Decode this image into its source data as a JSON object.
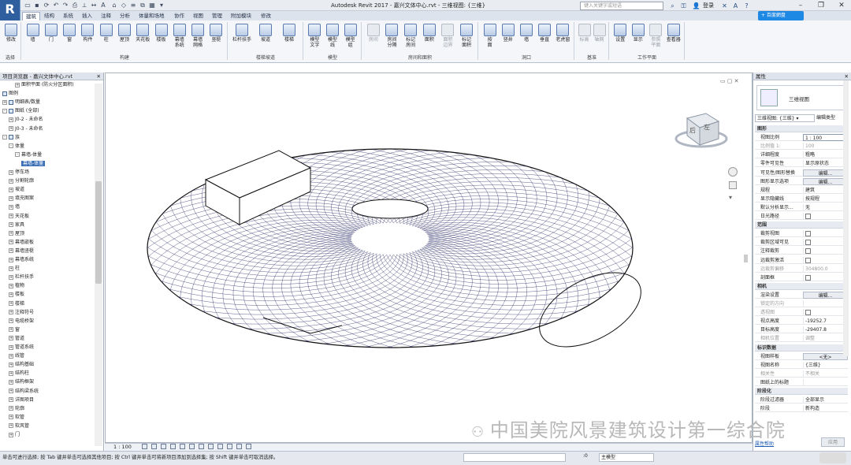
{
  "app": {
    "logo": "R",
    "window_title": "Autodesk Revit 2017 -    嘉兴文体中心.rvt - 三维视图: {三维}",
    "search_placeholder": "键入关键字或短语",
    "login": "登录",
    "cloud_button": "+ 百度網盘"
  },
  "tabs": [
    "建筑",
    "结构",
    "系统",
    "插入",
    "注释",
    "分析",
    "体量和场地",
    "协作",
    "视图",
    "管理",
    "附加模块",
    "修改"
  ],
  "active_tab": "建筑",
  "ribbon": {
    "modify": "修改",
    "select_label": "选择",
    "build": {
      "label": "构建",
      "items": [
        "墙",
        "门",
        "窗",
        "构件",
        "柱",
        "屋顶",
        "天花板",
        "楼板",
        "幕墙\n系统",
        "幕墙\n网格",
        "竖梃"
      ]
    },
    "circulation": {
      "label": "楼梯坡道",
      "items": [
        "栏杆扶手",
        "坡道",
        "楼梯"
      ]
    },
    "model": {
      "label": "模型",
      "items": [
        "模型\n文字",
        "模型\n线",
        "模型\n组"
      ]
    },
    "room": {
      "label": "房间和面积",
      "items": [
        "房间",
        "房间\n分隔",
        "标记\n房间",
        "面积",
        "面积\n边界",
        "标记\n面积"
      ]
    },
    "opening": {
      "label": "洞口",
      "items": [
        "按\n面",
        "竖井",
        "墙",
        "垂直",
        "老虎窗"
      ]
    },
    "datum": {
      "label": "基准",
      "items": [
        "标高",
        "轴网"
      ]
    },
    "workplane": {
      "label": "工作平面",
      "items": [
        "设置",
        "显示",
        "参照\n平面",
        "查看器"
      ]
    }
  },
  "browser": {
    "title": "项目浏览器 - 嘉兴文体中心.rvt",
    "items": [
      {
        "label": "面积平面 (防火分区面积)",
        "indent": 2,
        "toggle": "+",
        "icon": false
      },
      {
        "label": "图例",
        "indent": 0,
        "toggle": "",
        "icon": true
      },
      {
        "label": "明细表/数量",
        "indent": 0,
        "toggle": "+",
        "icon": true
      },
      {
        "label": "图纸 (全部)",
        "indent": 0,
        "toggle": "-",
        "icon": true
      },
      {
        "label": "J0-2 - 未命名",
        "indent": 1,
        "toggle": "+",
        "icon": false
      },
      {
        "label": "J0-3 - 未命名",
        "indent": 1,
        "toggle": "+",
        "icon": false
      },
      {
        "label": "族",
        "indent": 0,
        "toggle": "-",
        "icon": true
      },
      {
        "label": "体量",
        "indent": 1,
        "toggle": "-",
        "icon": false
      },
      {
        "label": "幕墙-体量",
        "indent": 2,
        "toggle": "-",
        "icon": false
      },
      {
        "label": "幕墙-体量",
        "indent": 3,
        "toggle": "",
        "icon": false,
        "selected": true
      },
      {
        "label": "停车场",
        "indent": 1,
        "toggle": "+",
        "icon": false
      },
      {
        "label": "分割轮廓",
        "indent": 1,
        "toggle": "+",
        "icon": false
      },
      {
        "label": "坡道",
        "indent": 1,
        "toggle": "+",
        "icon": false
      },
      {
        "label": "填充图案",
        "indent": 1,
        "toggle": "+",
        "icon": false
      },
      {
        "label": "墙",
        "indent": 1,
        "toggle": "+",
        "icon": false
      },
      {
        "label": "天花板",
        "indent": 1,
        "toggle": "+",
        "icon": false
      },
      {
        "label": "家具",
        "indent": 1,
        "toggle": "+",
        "icon": false
      },
      {
        "label": "屋顶",
        "indent": 1,
        "toggle": "+",
        "icon": false
      },
      {
        "label": "幕墙嵌板",
        "indent": 1,
        "toggle": "+",
        "icon": false
      },
      {
        "label": "幕墙竖梃",
        "indent": 1,
        "toggle": "+",
        "icon": false
      },
      {
        "label": "幕墙系统",
        "indent": 1,
        "toggle": "+",
        "icon": false
      },
      {
        "label": "柱",
        "indent": 1,
        "toggle": "+",
        "icon": false
      },
      {
        "label": "栏杆扶手",
        "indent": 1,
        "toggle": "+",
        "icon": false
      },
      {
        "label": "植物",
        "indent": 1,
        "toggle": "+",
        "icon": false
      },
      {
        "label": "楼板",
        "indent": 1,
        "toggle": "+",
        "icon": false
      },
      {
        "label": "楼梯",
        "indent": 1,
        "toggle": "+",
        "icon": false
      },
      {
        "label": "注释符号",
        "indent": 1,
        "toggle": "+",
        "icon": false
      },
      {
        "label": "电缆桥架",
        "indent": 1,
        "toggle": "+",
        "icon": false
      },
      {
        "label": "窗",
        "indent": 1,
        "toggle": "+",
        "icon": false
      },
      {
        "label": "管道",
        "indent": 1,
        "toggle": "+",
        "icon": false
      },
      {
        "label": "管道系统",
        "indent": 1,
        "toggle": "+",
        "icon": false
      },
      {
        "label": "线管",
        "indent": 1,
        "toggle": "+",
        "icon": false
      },
      {
        "label": "结构基础",
        "indent": 1,
        "toggle": "+",
        "icon": false
      },
      {
        "label": "结构柱",
        "indent": 1,
        "toggle": "+",
        "icon": false
      },
      {
        "label": "结构框架",
        "indent": 1,
        "toggle": "+",
        "icon": false
      },
      {
        "label": "结构梁系统",
        "indent": 1,
        "toggle": "+",
        "icon": false
      },
      {
        "label": "详图项目",
        "indent": 1,
        "toggle": "+",
        "icon": false
      },
      {
        "label": "轮廓",
        "indent": 1,
        "toggle": "+",
        "icon": false
      },
      {
        "label": "软管",
        "indent": 1,
        "toggle": "+",
        "icon": false
      },
      {
        "label": "软风管",
        "indent": 1,
        "toggle": "+",
        "icon": false
      },
      {
        "label": "门",
        "indent": 1,
        "toggle": "+",
        "icon": false
      }
    ]
  },
  "properties": {
    "title": "属性",
    "type_name": "三维视图",
    "selector": "三维视图: {三维}",
    "edit_type": "编辑类型",
    "rows": [
      {
        "group": "图形"
      },
      {
        "k": "视图比例",
        "v": "1 : 100",
        "input": true
      },
      {
        "k": "比例值 1:",
        "v": "100",
        "dis": true
      },
      {
        "k": "详细程度",
        "v": "粗略"
      },
      {
        "k": "零件可见性",
        "v": "显示原状态"
      },
      {
        "k": "可见性/图形替换",
        "v": "编辑...",
        "btn": true
      },
      {
        "k": "图形显示选项",
        "v": "编辑...",
        "btn": true
      },
      {
        "k": "规程",
        "v": "建筑"
      },
      {
        "k": "显示隐藏线",
        "v": "按规程"
      },
      {
        "k": "默认分析显示...",
        "v": "无"
      },
      {
        "k": "日光路径",
        "v": "",
        "cb": true
      },
      {
        "group": "范围"
      },
      {
        "k": "裁剪视图",
        "v": "",
        "cb": true
      },
      {
        "k": "裁剪区域可见",
        "v": "",
        "cb": true
      },
      {
        "k": "注释裁剪",
        "v": "",
        "cb": true
      },
      {
        "k": "远裁剪激活",
        "v": "",
        "cb": true
      },
      {
        "k": "远裁剪偏移",
        "v": "304800.0",
        "dis": true
      },
      {
        "k": "剖面框",
        "v": "",
        "cb": true
      },
      {
        "group": "相机"
      },
      {
        "k": "渲染设置",
        "v": "编辑...",
        "btn": true
      },
      {
        "k": "锁定的方向",
        "v": "",
        "dis": true
      },
      {
        "k": "透视图",
        "v": "",
        "dis": true,
        "cb": true
      },
      {
        "k": "视点高度",
        "v": "-19252.7"
      },
      {
        "k": "目标高度",
        "v": "-29407.8"
      },
      {
        "k": "相机位置",
        "v": "调整",
        "dis": true
      },
      {
        "group": "标识数据"
      },
      {
        "k": "视图样板",
        "v": "<无>",
        "btn": true
      },
      {
        "k": "视图名称",
        "v": "{三维}"
      },
      {
        "k": "相关性",
        "v": "不相关",
        "dis": true
      },
      {
        "k": "图纸上的标题",
        "v": ""
      },
      {
        "group": "阶段化"
      },
      {
        "k": "阶段过滤器",
        "v": "全部显示"
      },
      {
        "k": "阶段",
        "v": "新构造"
      }
    ],
    "help_link": "属性帮助",
    "apply": "应用"
  },
  "viewcube": {
    "top": "后",
    "side": "左"
  },
  "view_scale": "1 : 100",
  "status": "单击可进行选择; 按 Tab 键并单击可选择其他项目; 按 Ctrl 键并单击可将新项目添加到选择集; 按 Shift 键并单击可取消选择。",
  "status_model": "主模型",
  "status_zero": ":0",
  "watermark": "中国美院风景建筑设计第一综合院"
}
